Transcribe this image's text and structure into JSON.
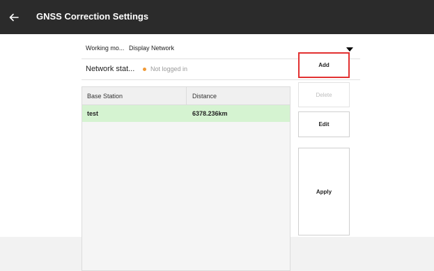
{
  "header": {
    "title": "GNSS Correction Settings",
    "back_icon": "arrow-left-icon"
  },
  "settings": {
    "working_mode_label": "Working mo...",
    "working_mode_value": "Display Network",
    "network_status_label": "Network stat...",
    "network_status_value": "Not logged in",
    "status_color": "#f09a37"
  },
  "table": {
    "columns": [
      "Base Station",
      "Distance"
    ],
    "rows": [
      {
        "base_station": "test",
        "distance": "6378.236km",
        "selected": true
      }
    ]
  },
  "actions": {
    "add": "Add",
    "delete": "Delete",
    "edit": "Edit",
    "apply": "Apply"
  },
  "colors": {
    "header_bg": "#2b2b2b",
    "selected_row": "#d5f3d1",
    "highlight_border": "#e23030"
  }
}
